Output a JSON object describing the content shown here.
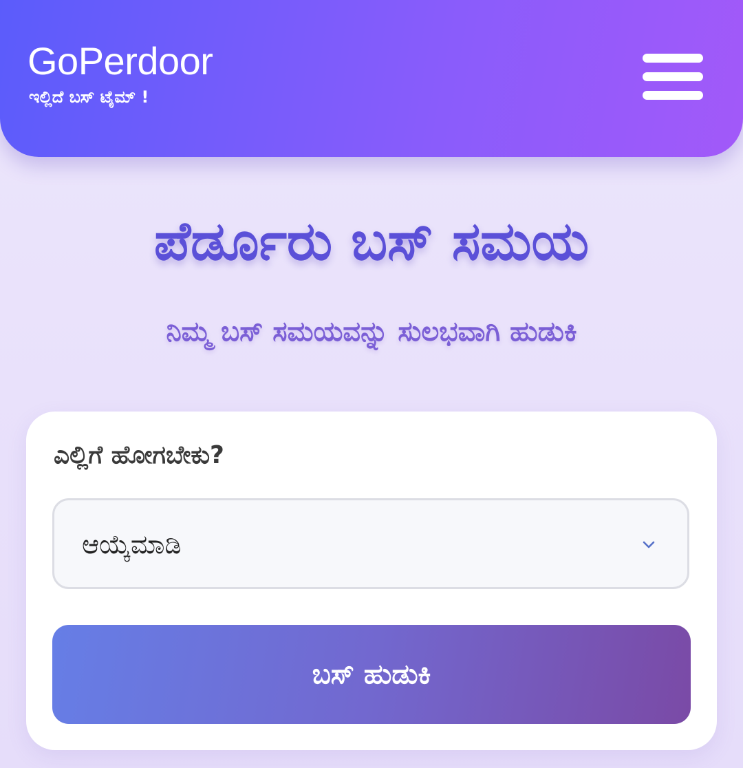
{
  "header": {
    "brand_title": "GoPerdoor",
    "brand_tagline": "ಇಲ್ಲಿದೆ ಬಸ್ ಟೈಮ್ !",
    "menu_icon": "hamburger-menu-icon"
  },
  "hero": {
    "title": "ಪೆರ್ಡೂರು ಬಸ್ ಸಮಯ",
    "subtitle": "ನಿಮ್ಮ ಬಸ್ ಸಮಯವನ್ನು ಸುಲಭವಾಗಿ ಹುಡುಕಿ"
  },
  "search_form": {
    "label": "ಎಲ್ಲಿಗೆ ಹೋಗಬೇಕು?",
    "destination_select": {
      "selected_value": "ಆಯ್ಕೆಮಾಡಿ",
      "icon": "chevron-down-icon"
    },
    "submit_label": "ಬಸ್ ಹುಡುಕಿ"
  },
  "colors": {
    "header_gradient_start": "#5b5cfb",
    "header_gradient_end": "#a259f9",
    "title_color": "#5b50d8",
    "subtitle_color": "#7b5fd6",
    "button_gradient_start": "#667ee6",
    "button_gradient_end": "#7a4aa6",
    "page_background": "#ece6fb"
  }
}
